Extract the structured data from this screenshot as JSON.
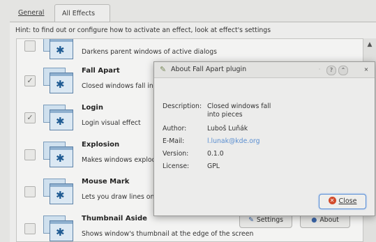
{
  "tabs": {
    "general": "General",
    "all_effects": "All Effects"
  },
  "hint": "Hint: to find out or configure how to activate an effect, look at effect's settings",
  "effects": [
    {
      "name": "",
      "description": "Darkens parent windows of active dialogs",
      "checked": false
    },
    {
      "name": "Fall Apart",
      "description": "Closed windows fall into pieces",
      "checked": true
    },
    {
      "name": "Login",
      "description": "Login visual effect",
      "checked": true
    },
    {
      "name": "Explosion",
      "description": "Makes windows explode when they are closed",
      "checked": false
    },
    {
      "name": "Mouse Mark",
      "description": "Lets you draw lines onto the desktop",
      "checked": false
    },
    {
      "name": "Thumbnail Aside",
      "description": "Shows window's thumbnail at the edge of the screen",
      "checked": false
    }
  ],
  "row_buttons": {
    "settings": "Settings",
    "about": "About"
  },
  "about_dialog": {
    "title": "About Fall Apart plugin",
    "description_label": "Description:",
    "description_line1": "Closed windows fall",
    "description_line2": "into pieces",
    "author_label": "Author:",
    "author": "Luboš Luňák",
    "email_label": "E-Mail:",
    "email": "l.lunak@kde.org",
    "version_label": "Version:",
    "version": "0.1.0",
    "license_label": "License:",
    "license": "GPL",
    "close_label": "Close"
  },
  "icons": {
    "effect_icon": "kde-gear-window-icon",
    "dialog_icon": "plugin-icon",
    "close_icon": "close-icon"
  }
}
